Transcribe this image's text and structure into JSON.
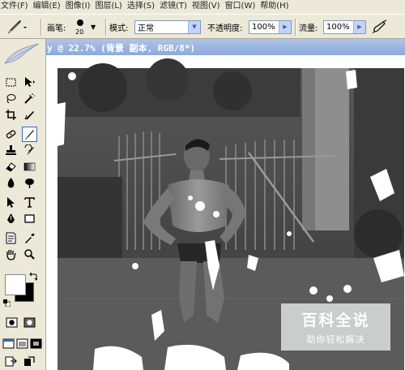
{
  "menu": [
    {
      "key": "file",
      "label": "文件(F)"
    },
    {
      "key": "edit",
      "label": "编辑(E)"
    },
    {
      "key": "image",
      "label": "图像(I)"
    },
    {
      "key": "layer",
      "label": "图层(L)"
    },
    {
      "key": "select",
      "label": "选择(S)"
    },
    {
      "key": "filter",
      "label": "滤镜(T)"
    },
    {
      "key": "view",
      "label": "视图(V)"
    },
    {
      "key": "window",
      "label": "窗口(W)"
    },
    {
      "key": "help",
      "label": "帮助(H)"
    }
  ],
  "options": {
    "brush_label": "画笔:",
    "brush_size": "20",
    "mode_label": "模式:",
    "mode_value": "正常",
    "opacity_label": "不透明度:",
    "opacity_value": "100%",
    "flow_label": "流量:",
    "flow_value": "100%"
  },
  "document": {
    "title": "y @ 22.7% (背景 副本, RGB/8*)"
  },
  "watermark": {
    "title": "百科全说",
    "subtitle": "助你轻松解决"
  },
  "colors": {
    "titlebar": "#9db6e0",
    "selection": "#316ac5",
    "foreground": "#ffffff",
    "background": "#000000"
  }
}
